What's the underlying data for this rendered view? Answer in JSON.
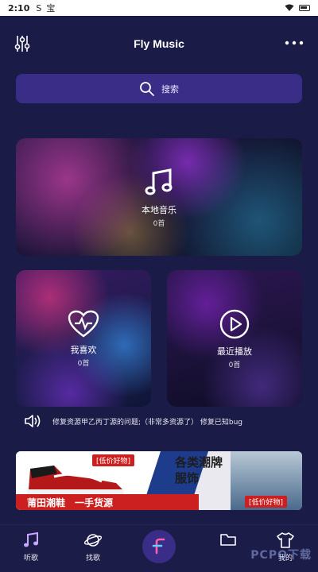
{
  "status_bar": {
    "time": "2:10",
    "indicator": "S",
    "app_glyph": "宝"
  },
  "header": {
    "title": "Fly Music"
  },
  "search": {
    "placeholder": "搜索"
  },
  "cards": {
    "local": {
      "label": "本地音乐",
      "count": "0首"
    },
    "like": {
      "label": "我喜欢",
      "count": "0首"
    },
    "recent": {
      "label": "最近播放",
      "count": "0首"
    }
  },
  "notice": {
    "text": "修复资源甲乙丙丁源的问题;（非常多资源了） 修复已知bug"
  },
  "banner": {
    "tag_left": "[低价好物]",
    "tag_right": "[低价好物]",
    "strip_a": "莆田潮鞋",
    "strip_b": "一手货源",
    "headline_1": "各类潮牌",
    "headline_2": "服饰"
  },
  "nav": {
    "listen": "听歌",
    "find": "找歌",
    "my": "我的"
  },
  "watermark": "PCPO下载",
  "colors": {
    "background": "#1b1b47",
    "accent": "#3a2d88",
    "banner_red": "#cc1f1f"
  },
  "icons": {
    "filter": "filter-sliders-icon",
    "more": "more-dots-icon",
    "search": "search-icon",
    "music_note": "music-note-icon",
    "heart": "heart-pulse-icon",
    "play": "play-circle-icon",
    "speaker": "speaker-icon"
  }
}
